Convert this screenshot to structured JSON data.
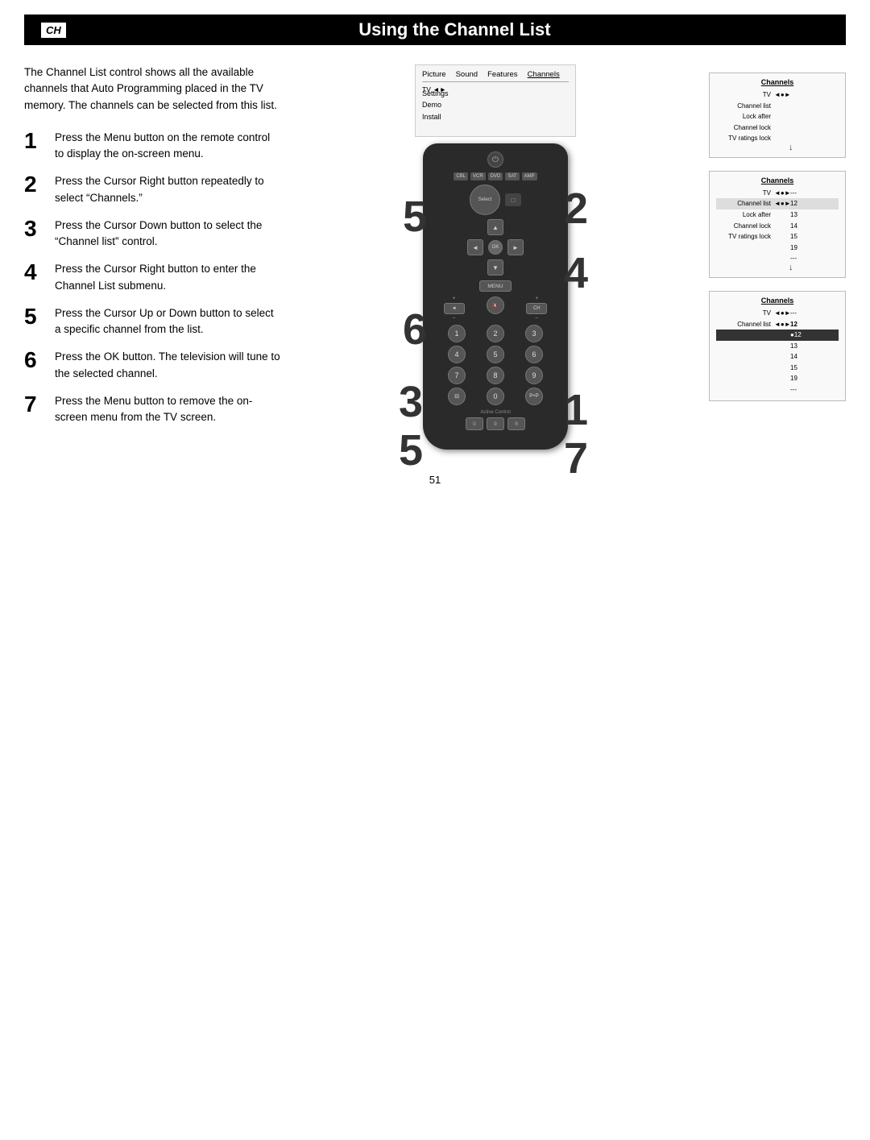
{
  "header": {
    "ch_label": "CH",
    "title": "Using the Channel List"
  },
  "intro": "The Channel List control shows all the available channels that Auto Programming placed in the TV memory. The channels can be selected from this list.",
  "steps": [
    {
      "num": "1",
      "text": "Press the Menu button on the remote control to display the on-screen menu."
    },
    {
      "num": "2",
      "text": "Press the Cursor Right button repeatedly to select “Channels.”"
    },
    {
      "num": "3",
      "text": "Press the Cursor Down button to select the “Channel list” control."
    },
    {
      "num": "4",
      "text": "Press the Cursor Right button to enter the Channel List submenu."
    },
    {
      "num": "5",
      "text": "Press the Cursor Up or Down button to select a specific channel from the list."
    },
    {
      "num": "6",
      "text": "Press the OK button. The television will tune to the selected channel."
    },
    {
      "num": "7",
      "text": "Press the Menu button to remove the on-screen menu from the TV screen."
    }
  ],
  "top_menu": {
    "items": [
      "Picture",
      "Sound",
      "Features",
      "Channels"
    ],
    "side_items": [
      "Settings",
      "Demo",
      "Install"
    ],
    "tv_label": "TV"
  },
  "diagrams": [
    {
      "title": "Channels",
      "tv_label": "TV",
      "rows": [
        {
          "label": "Channel list",
          "arrow": "◄►",
          "val": ""
        },
        {
          "label": "Lock after",
          "arrow": "",
          "val": ""
        },
        {
          "label": "Channel lock",
          "arrow": "",
          "val": ""
        },
        {
          "label": "TV ratings lock",
          "arrow": "",
          "val": ""
        }
      ],
      "has_cursor": false
    },
    {
      "title": "Channels",
      "tv_label": "TV",
      "rows": [
        {
          "label": "Channel list",
          "arrow": "◄►",
          "val": "---",
          "selected": false
        },
        {
          "label": "Lock after",
          "arrow": "",
          "val": "12"
        },
        {
          "label": "Channel lock",
          "arrow": "",
          "val": "13"
        },
        {
          "label": "TV ratings lock",
          "arrow": "",
          "val": "14"
        },
        {
          "label": "",
          "arrow": "",
          "val": "15"
        },
        {
          "label": "",
          "arrow": "",
          "val": "19"
        },
        {
          "label": "",
          "arrow": "",
          "val": "---"
        }
      ],
      "has_cursor": true,
      "cursor_row": 0
    },
    {
      "title": "Channels",
      "tv_label": "TV",
      "rows": [
        {
          "label": "Channel list",
          "arrow": "◄►",
          "val": "---",
          "selected": false
        },
        {
          "label": "",
          "arrow": "",
          "val": "12",
          "selected": true
        },
        {
          "label": "",
          "arrow": "",
          "val": "13"
        },
        {
          "label": "",
          "arrow": "",
          "val": "14"
        },
        {
          "label": "",
          "arrow": "",
          "val": "15"
        },
        {
          "label": "",
          "arrow": "",
          "val": "19"
        },
        {
          "label": "",
          "arrow": "",
          "val": "---"
        }
      ],
      "has_cursor": true,
      "cursor_row": 1
    }
  ],
  "big_step_labels": {
    "label_5a": "5",
    "label_2": "2",
    "label_4": "4",
    "label_6": "6",
    "label_3": "3",
    "label_5b": "5",
    "label_1": "1",
    "label_7": "7"
  },
  "remote": {
    "source_buttons": [
      "CBL",
      "VCR",
      "DVD",
      "SAT",
      "AMP"
    ],
    "num_buttons": [
      "1",
      "2",
      "3",
      "4",
      "5",
      "6",
      "7",
      "8",
      "9",
      "⊟",
      "0",
      "P+P"
    ],
    "special_buttons": [
      "⊟",
      "⊟",
      "P+P"
    ],
    "active_control_label": "Active Control",
    "active_btns": [
      "①",
      "②",
      "③"
    ]
  },
  "page_number": "51"
}
